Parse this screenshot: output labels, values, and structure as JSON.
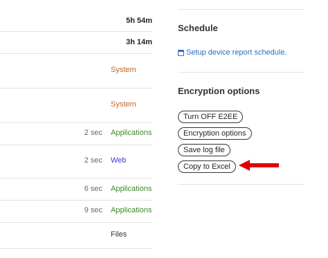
{
  "table": {
    "rows": [
      {
        "time": "",
        "duration": "5h 54m",
        "category": "",
        "category_color": ""
      },
      {
        "time": "",
        "duration": "3h 14m",
        "category": "",
        "category_color": ""
      },
      {
        "time": "",
        "duration": "",
        "category": "System",
        "category_color": "#c0662a"
      },
      {
        "time": "",
        "duration": "",
        "category": "System",
        "category_color": "#c0662a"
      },
      {
        "time": "2 sec",
        "duration": "",
        "category": "Applications",
        "category_color": "#3a8a2a"
      },
      {
        "time": "2 sec",
        "duration": "",
        "category": "Web",
        "category_color": "#3a3acc"
      },
      {
        "time": "6 sec",
        "duration": "",
        "category": "Applications",
        "category_color": "#3a8a2a"
      },
      {
        "time": "9 sec",
        "duration": "",
        "category": "Applications",
        "category_color": "#3a8a2a"
      },
      {
        "time": "",
        "duration": "",
        "category": "Files",
        "category_color": "#333333"
      }
    ]
  },
  "schedule": {
    "title": "Schedule",
    "link_label": "Setup device report schedule.",
    "link_icon": "calendar-icon"
  },
  "encryption": {
    "title": "Encryption options",
    "buttons": [
      {
        "label": "Turn OFF E2EE",
        "name": "turn-off-e2ee-button"
      },
      {
        "label": "Encryption options",
        "name": "encryption-options-button"
      },
      {
        "label": "Save log file",
        "name": "save-log-file-button"
      },
      {
        "label": "Copy to Excel",
        "name": "copy-to-excel-button"
      }
    ]
  },
  "annotation": {
    "arrow_icon": "red-arrow-left-icon",
    "arrow_color": "#e00000"
  },
  "colors": {
    "link": "#2a6ebb",
    "divider": "#e3e3e3"
  }
}
